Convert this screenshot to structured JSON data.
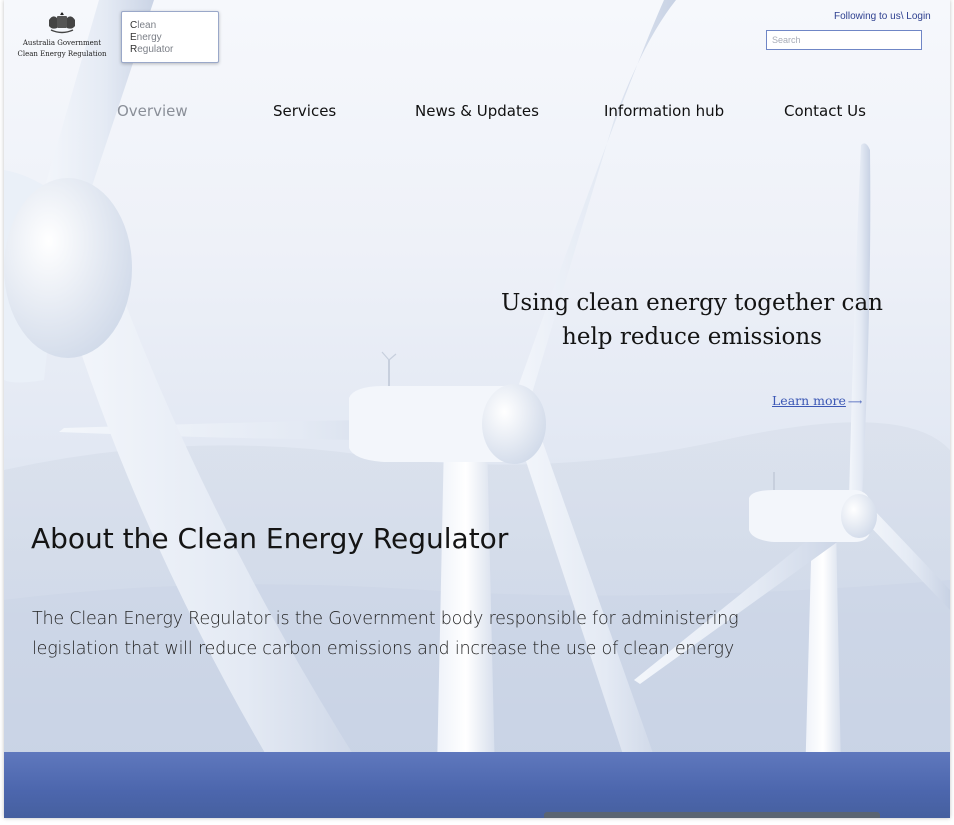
{
  "header": {
    "gov_line1": "Australia Government",
    "gov_line2": "Clean Energy Regulation",
    "logo_lines": [
      {
        "initial": "C",
        "rest": "lean"
      },
      {
        "initial": "E",
        "rest": "nergy"
      },
      {
        "initial": "R",
        "rest": "egulator"
      }
    ],
    "login_link": "Following to us\\ Login",
    "search": {
      "placeholder": "Search",
      "value": ""
    }
  },
  "nav": {
    "items": [
      {
        "label": "Overview",
        "active": true
      },
      {
        "label": "Services",
        "active": false
      },
      {
        "label": "News & Updates",
        "active": false
      },
      {
        "label": "Information hub",
        "active": false
      },
      {
        "label": "Contact Us",
        "active": false
      }
    ]
  },
  "hero": {
    "heading_line1": "Using clean energy together can",
    "heading_line2": "help reduce emissions",
    "cta": "Learn more"
  },
  "about": {
    "title": "About the Clean Energy Regulator",
    "body": "The Clean Energy Regulator is the Government body responsible for administering legislation that will reduce carbon emissions and increase the use of clean energy"
  },
  "icons": {
    "crest": "australian-coat-of-arms-icon",
    "learn_more_arrow": "arrow-right-icon"
  },
  "colors": {
    "accent": "#3b57b5",
    "link_dark": "#2d3f8f",
    "band": "#4c66ad",
    "nav_active": "#8a8f98"
  }
}
